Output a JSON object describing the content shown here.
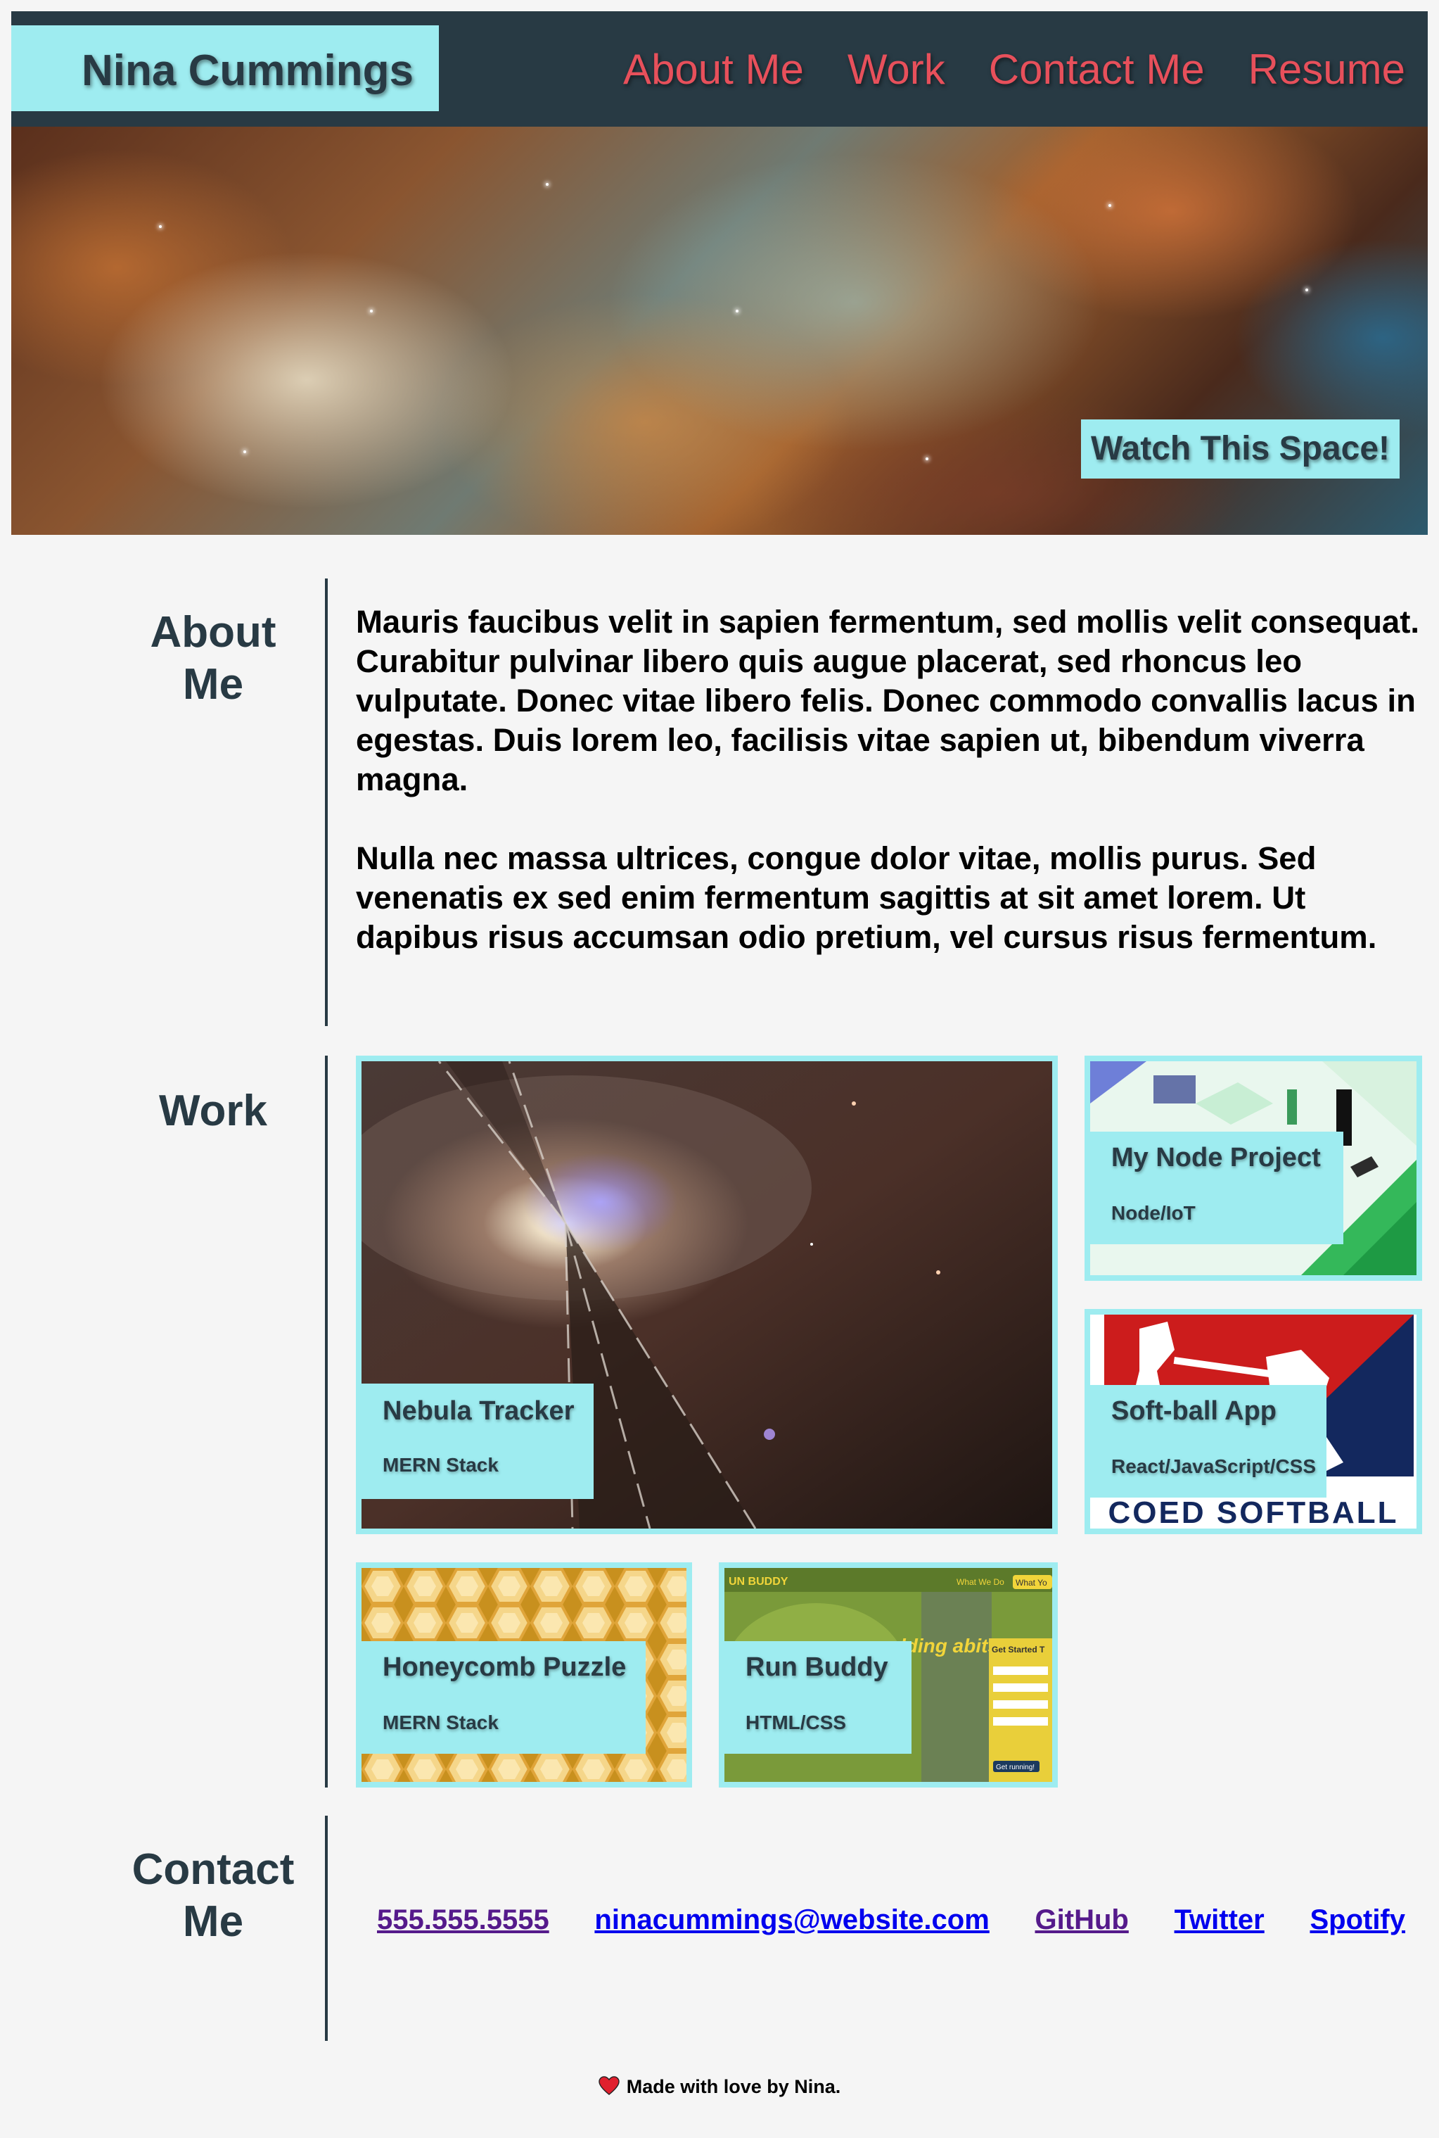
{
  "header": {
    "name": "Nina Cummings",
    "nav": [
      "About Me",
      "Work",
      "Contact Me",
      "Resume"
    ]
  },
  "hero": {
    "badge": "Watch This Space!"
  },
  "about": {
    "title_line1": "About",
    "title_line2": "Me",
    "paragraphs": [
      "Mauris faucibus velit in sapien fermentum, sed mollis velit consequat. Curabitur pulvinar libero quis augue placerat, sed rhoncus leo vulputate. Donec vitae libero felis. Donec commodo convallis lacus in egestas. Duis lorem leo, facilisis vitae sapien ut, bibendum viverra magna.",
      "Nulla nec massa ultrices, congue dolor vitae, mollis purus. Sed venenatis ex sed enim fermentum sagittis at sit amet lorem. Ut dapibus risus accumsan odio pretium, vel cursus risus fermentum."
    ]
  },
  "work": {
    "title": "Work",
    "projects": [
      {
        "title": "Nebula Tracker",
        "stack": "MERN Stack",
        "art": "nebula-galaxy-image"
      },
      {
        "title": "My Node Project",
        "stack": "Node/IoT",
        "art": "isometric-node-illustration"
      },
      {
        "title": "Soft-ball App",
        "stack": "React/JavaScript/CSS",
        "art": "coed-softball-logo"
      },
      {
        "title": "Honeycomb Puzzle",
        "stack": "MERN Stack",
        "art": "honeycomb-image"
      },
      {
        "title": "Run Buddy",
        "stack": "HTML/CSS",
        "art": "run-buddy-screenshot"
      }
    ],
    "softball_logo_text": "COED SOFTBALL",
    "run_buddy_brand": "UN BUDDY",
    "run_buddy_nav": [
      "What We Do",
      "What Yo"
    ],
    "run_buddy_headline": "lding abits.",
    "run_buddy_form_title": "Get Started T",
    "run_buddy_button": "Get running!"
  },
  "contact": {
    "title_line1": "Contact",
    "title_line2": "Me",
    "links": [
      "555.555.5555",
      "ninacummings@website.com",
      "GitHub",
      "Twitter",
      "Spotify"
    ]
  },
  "footer": {
    "text": "Made with love by Nina.",
    "icon": "heart-icon"
  },
  "colors": {
    "header_bg": "#283a44",
    "accent": "#9eecf0",
    "nav_link": "#e7505b",
    "page_bg": "#f5f5f5"
  }
}
